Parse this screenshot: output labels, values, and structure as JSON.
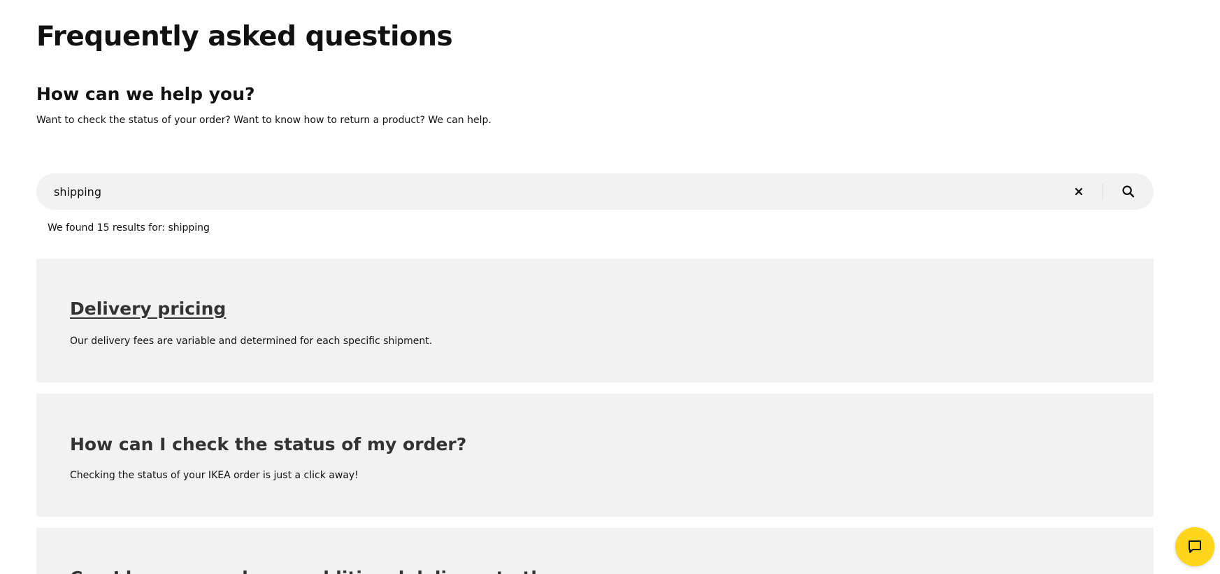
{
  "page": {
    "title": "Frequently asked questions"
  },
  "help": {
    "heading": "How can we help you?",
    "description": "Want to check the status of your order? Want to know how to return a product? We can help."
  },
  "search": {
    "value": "shipping",
    "clear_icon": "close-icon",
    "search_icon": "search-icon"
  },
  "results": {
    "summary": "We found 15 results for: shipping",
    "items": [
      {
        "title": "Delivery pricing",
        "description": "Our delivery fees are variable and determined for each specific shipment."
      },
      {
        "title": "How can I check the status of my order?",
        "description": "Checking the status of your IKEA order is just a click away!"
      },
      {
        "title": "Can I have my order an additional delivery to the",
        "description": ""
      }
    ]
  },
  "chat": {
    "icon": "chat-icon",
    "color": "#ffd619"
  },
  "colors": {
    "card_background": "#f2f2f2",
    "search_background": "#f2f2f2",
    "accent_yellow": "#ffd619"
  }
}
